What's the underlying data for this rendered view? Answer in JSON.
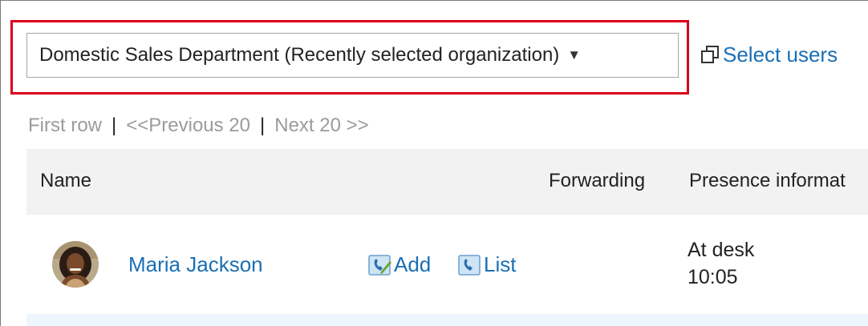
{
  "organization_select": {
    "selected": "Domestic Sales Department (Recently selected organization)",
    "caret": "▼"
  },
  "select_users": {
    "label": "Select users",
    "icon": "window-popup-icon"
  },
  "pager": {
    "first": "First row",
    "separator": "|",
    "previous": "<<Previous 20",
    "next": "Next 20 >>"
  },
  "table": {
    "columns": {
      "name": "Name",
      "forwarding": "Forwarding",
      "presence": "Presence informat"
    },
    "rows": [
      {
        "name": "Maria Jackson",
        "add_label": "Add",
        "list_label": "List",
        "presence_status": "At desk",
        "presence_time": "10:05"
      }
    ]
  },
  "colors": {
    "link": "#1a6fb5",
    "highlight": "#d9001b",
    "header_bg": "#f2f2f2",
    "disabled_text": "#9b9b9b"
  }
}
